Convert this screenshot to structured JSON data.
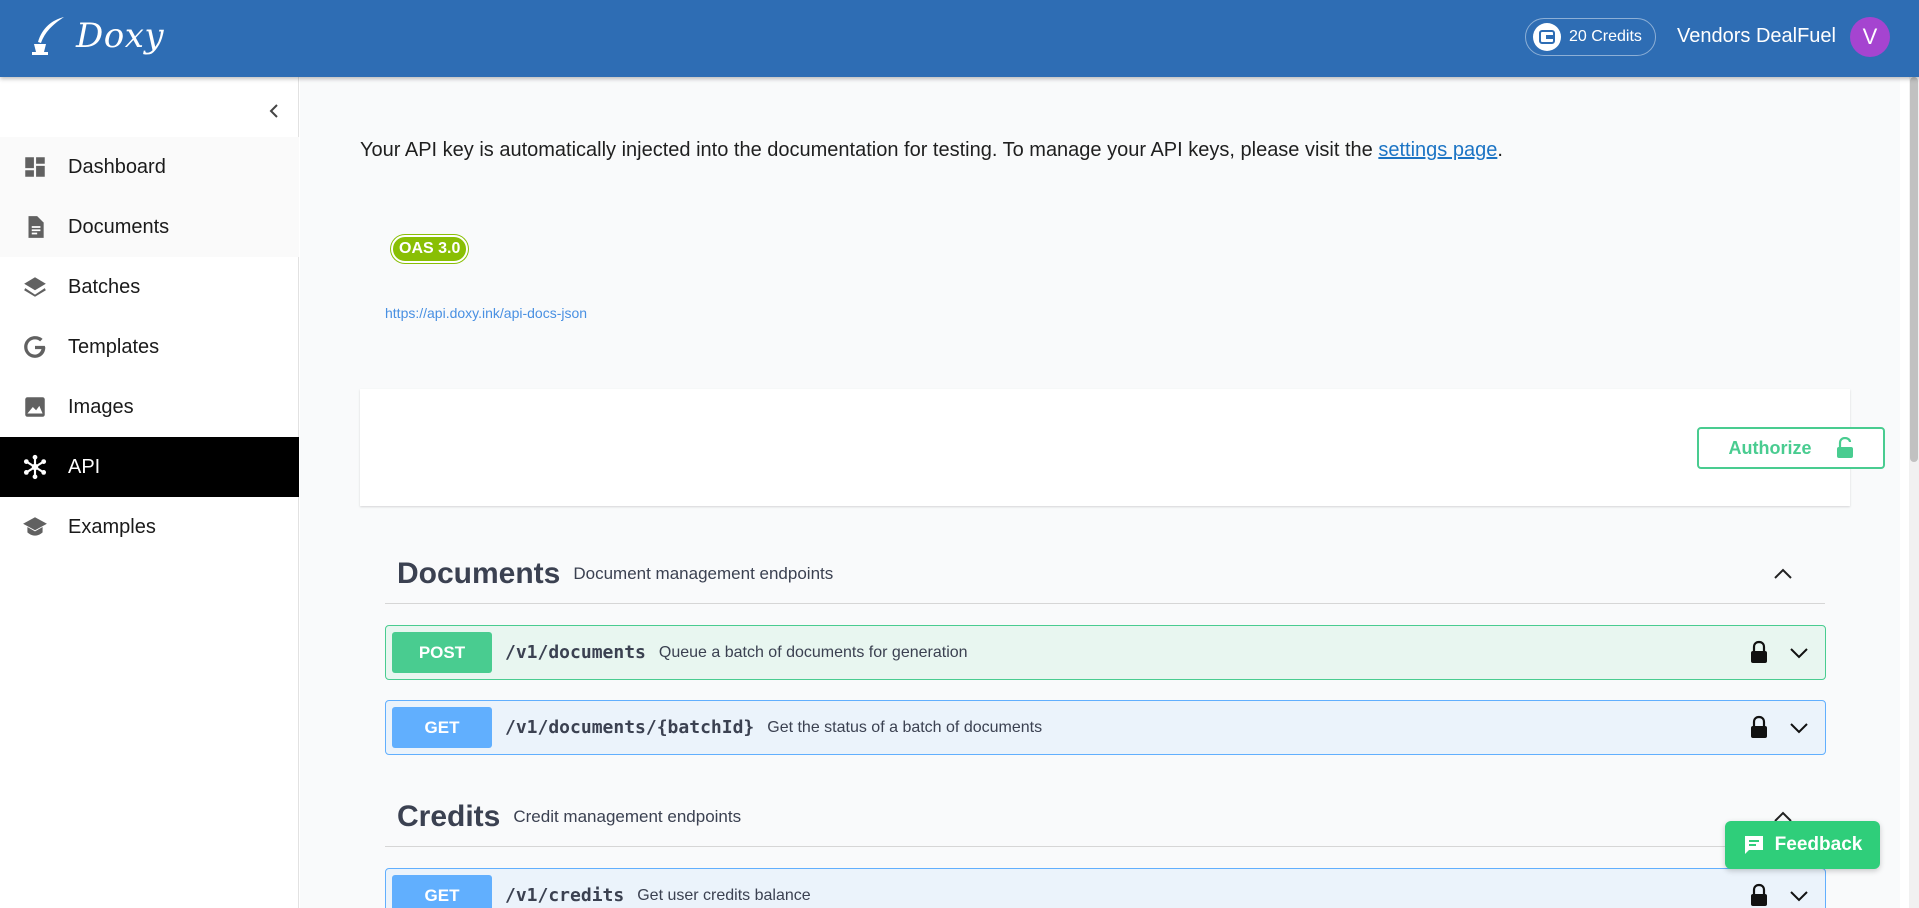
{
  "header": {
    "logo_text": "Doxy",
    "credits_label": "20 Credits",
    "user_name": "Vendors DealFuel",
    "avatar_initial": "V"
  },
  "sidebar": {
    "items": [
      {
        "label": "Dashboard",
        "icon": "dashboard-icon"
      },
      {
        "label": "Documents",
        "icon": "document-icon"
      },
      {
        "label": "Batches",
        "icon": "layers-icon"
      },
      {
        "label": "Templates",
        "icon": "google-icon"
      },
      {
        "label": "Images",
        "icon": "image-icon"
      },
      {
        "label": "API",
        "icon": "api-hub-icon",
        "active": true
      },
      {
        "label": "Examples",
        "icon": "school-icon"
      }
    ]
  },
  "main": {
    "notice_prefix": "Your API key is automatically injected into the documentation for testing. To manage your API keys, please visit the ",
    "notice_link": "settings page",
    "notice_suffix": ".",
    "oas_badge": "OAS 3.0",
    "spec_url": "https://api.doxy.ink/api-docs-json",
    "authorize_label": "Authorize",
    "sections": [
      {
        "title": "Documents",
        "description": "Document management endpoints",
        "operations": [
          {
            "method": "POST",
            "path": "/v1/documents",
            "summary": "Queue a batch of documents for generation"
          },
          {
            "method": "GET",
            "path": "/v1/documents/{batchId}",
            "summary": "Get the status of a batch of documents"
          }
        ]
      },
      {
        "title": "Credits",
        "description": "Credit management endpoints",
        "operations": [
          {
            "method": "GET",
            "path": "/v1/credits",
            "summary": "Get user credits balance"
          }
        ]
      }
    ]
  },
  "feedback_label": "Feedback",
  "colors": {
    "header_bg": "#2e6db4",
    "post": "#49cc90",
    "get": "#61affe",
    "oas": "#89bf04",
    "feedback": "#2fce7a"
  }
}
